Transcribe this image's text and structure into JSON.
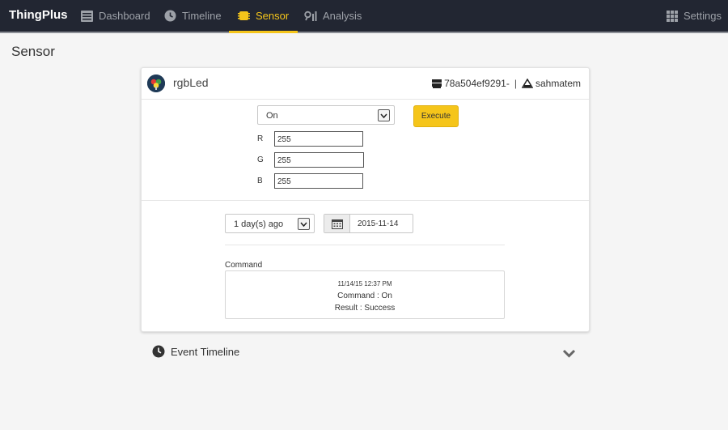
{
  "nav": {
    "brand": "ThingPlus",
    "items": [
      {
        "label": "Dashboard",
        "icon": "dashboard-icon"
      },
      {
        "label": "Timeline",
        "icon": "clock-icon"
      },
      {
        "label": "Sensor",
        "icon": "chip-icon",
        "active": true
      },
      {
        "label": "Analysis",
        "icon": "analysis-icon"
      }
    ],
    "settings_label": "Settings"
  },
  "page": {
    "title": "Sensor"
  },
  "device": {
    "name": "rgbLed",
    "gateway_id": "78a504ef9291-",
    "separator": "|",
    "owner": "sahmatem"
  },
  "control": {
    "command_value": "On",
    "execute_label": "Execute",
    "rgb": [
      {
        "label": "R",
        "value": "255"
      },
      {
        "label": "G",
        "value": "255"
      },
      {
        "label": "B",
        "value": "255"
      }
    ]
  },
  "history": {
    "period_value": "1 day(s) ago",
    "date_value": "2015-11-14",
    "section_label": "Command",
    "log": {
      "time": "11/14/15 12:37 PM",
      "command": "Command : On",
      "result": "Result : Success"
    }
  },
  "event_timeline": {
    "label": "Event Timeline"
  },
  "colors": {
    "accent": "#f5c51a",
    "navbar": "#222632",
    "nav_text": "#9da1a8"
  }
}
